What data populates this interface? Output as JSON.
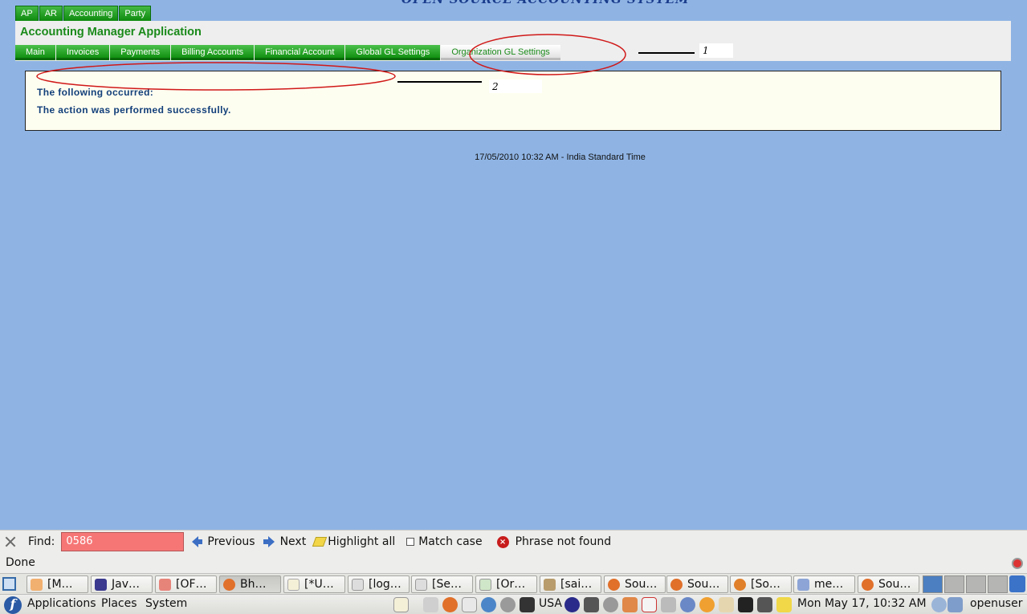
{
  "webpage": {
    "top_tabs": [
      "AP",
      "AR",
      "Accounting",
      "Party"
    ],
    "app_title": "Accounting Manager Application",
    "sub_tabs": [
      "Main",
      "Invoices",
      "Payments",
      "Billing Accounts",
      "Financial Account",
      "Global GL Settings",
      "Organization GL Settings"
    ],
    "selected_sub_tab": "Organization GL Settings",
    "annotation_1": "1",
    "annotation_2": "2",
    "message_heading": "The following occurred:",
    "message_text": "The action was performed successfully.",
    "footer_timestamp": "17/05/2010 10:32 AM - India Standard Time"
  },
  "find_bar": {
    "label": "Find:",
    "value": "0586",
    "previous_label": "Previous",
    "next_label": "Next",
    "highlight_label": "Highlight all",
    "match_case_label": "Match case",
    "match_case_checked": false,
    "status": "Phrase not found"
  },
  "status_bar": {
    "text": "Done"
  },
  "window_list": {
    "tasks": [
      {
        "label": "[M…",
        "icon": "app-icon",
        "active": false
      },
      {
        "label": "Jav…",
        "icon": "eclipse-icon",
        "active": false
      },
      {
        "label": "[OF…",
        "icon": "app-icon",
        "active": false
      },
      {
        "label": "Bh…",
        "icon": "firefox-icon",
        "active": true
      },
      {
        "label": "[*U…",
        "icon": "text-editor-icon",
        "active": false
      },
      {
        "label": "[log…",
        "icon": "document-icon",
        "active": false
      },
      {
        "label": "[Se…",
        "icon": "document-icon",
        "active": false
      },
      {
        "label": "[Or…",
        "icon": "document-icon",
        "active": false
      },
      {
        "label": "[sai…",
        "icon": "archive-icon",
        "active": false
      },
      {
        "label": "Sou…",
        "icon": "firefox-icon",
        "active": false
      },
      {
        "label": "Sou…",
        "icon": "firefox-icon",
        "active": false
      },
      {
        "label": "[So…",
        "icon": "firefox-icon",
        "active": false
      },
      {
        "label": "me…",
        "icon": "paint-icon",
        "active": false
      },
      {
        "label": "Sou…",
        "icon": "firefox-icon",
        "active": false
      }
    ]
  },
  "panel": {
    "menus": [
      "Applications",
      "Places",
      "System"
    ],
    "keyboard_layout": "USA",
    "clock": "Mon May 17, 10:32 AM",
    "user": "openuser"
  },
  "colors": {
    "page_background": "#8fb4e4",
    "tab_green": "#119011",
    "title_green": "#1a8a1a",
    "message_text": "#123f7a",
    "annotation_red": "#d01818",
    "find_not_found": "#f67676"
  }
}
